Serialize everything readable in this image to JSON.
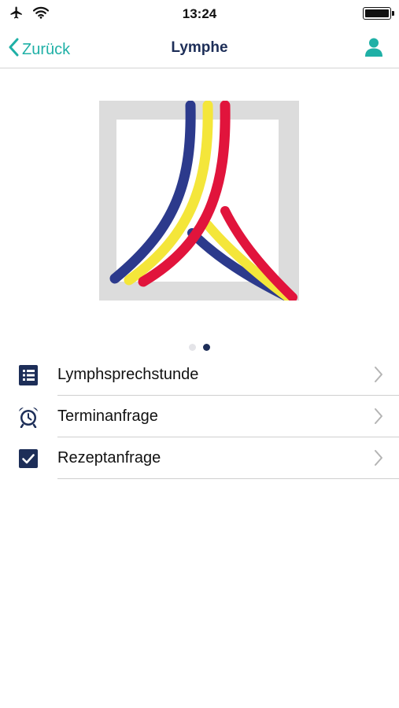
{
  "status_bar": {
    "time": "13:24",
    "icons": [
      "airplane-icon",
      "wifi-icon",
      "battery-icon"
    ],
    "battery_level": 1.0
  },
  "nav": {
    "back_label": "Zurück",
    "title": "Lymphe",
    "profile_icon": "user-icon"
  },
  "colors": {
    "accent": "#1fb0a6",
    "title": "#1d2e58",
    "logo_blue": "#2c3a8c",
    "logo_yellow": "#f4e63a",
    "logo_red": "#e1143c",
    "logo_frame": "#dcdcdc"
  },
  "carousel": {
    "page_count": 2,
    "current_page": 2
  },
  "menu": {
    "items": [
      {
        "label": "Lymphsprechstunde",
        "icon": "document-list-icon"
      },
      {
        "label": "Terminanfrage",
        "icon": "alarm-clock-icon"
      },
      {
        "label": "Rezeptanfrage",
        "icon": "checkbox-icon"
      }
    ]
  }
}
